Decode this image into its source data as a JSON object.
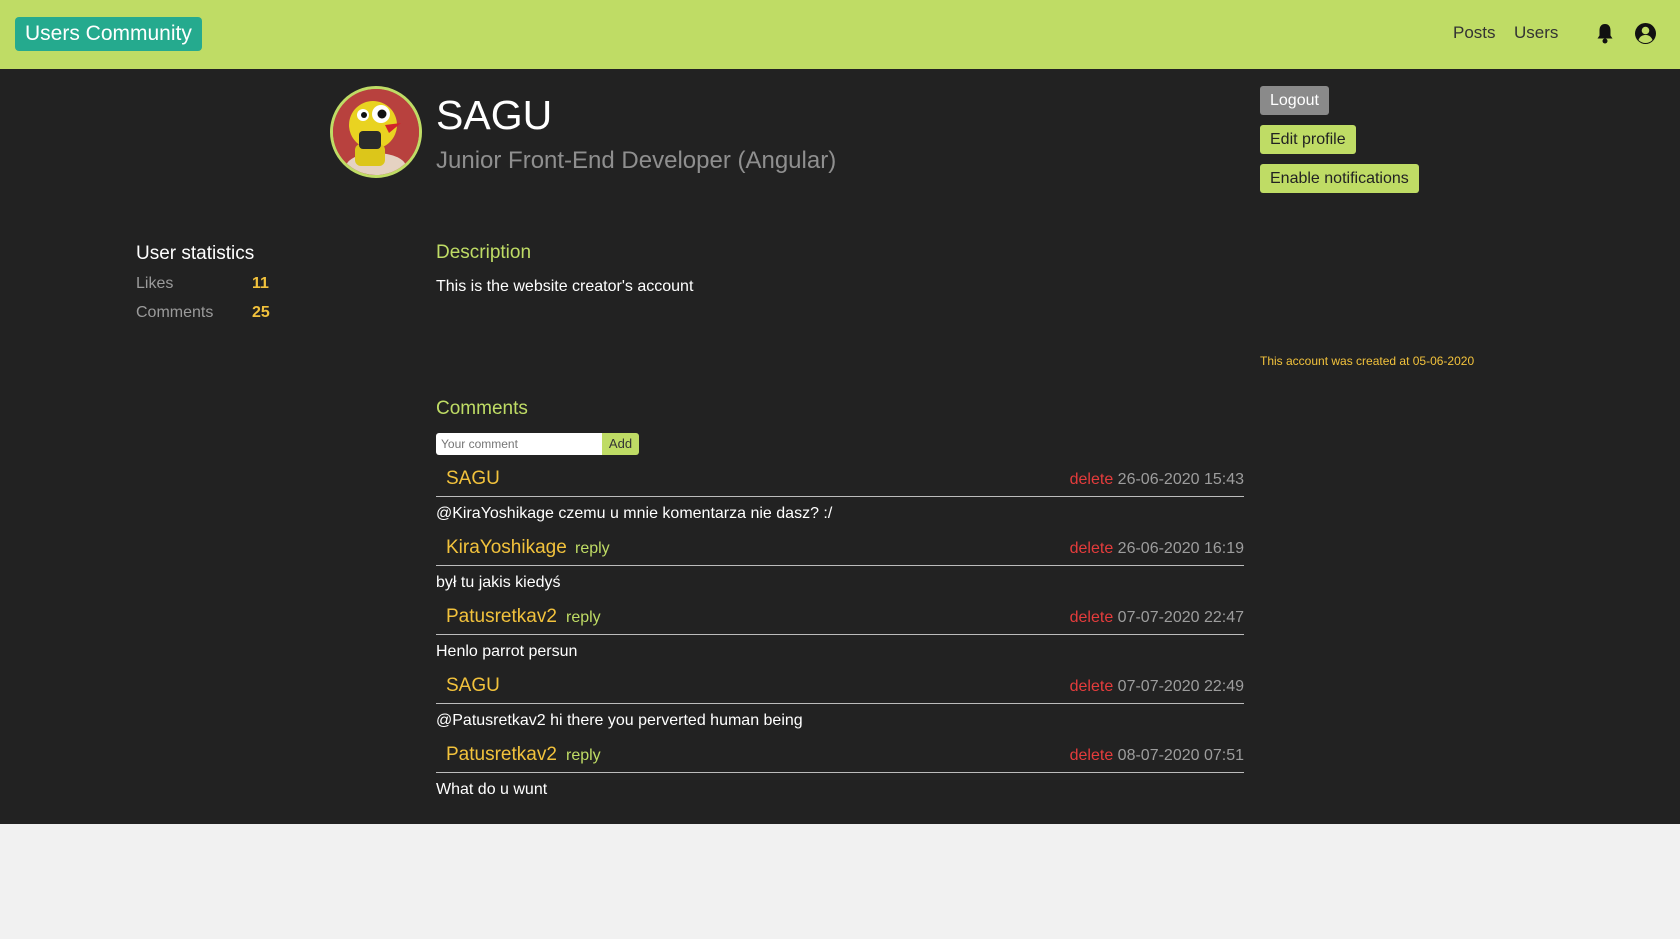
{
  "header": {
    "brand": "Users Community",
    "nav": [
      "Posts",
      "Users"
    ],
    "icons": [
      "bell-icon",
      "account-circle-icon"
    ],
    "colors": {
      "bar": "#bfdc65",
      "brand": "#25aa8e"
    }
  },
  "profile": {
    "name": "SAGU",
    "job": "Junior Front-End Developer (Angular)"
  },
  "actions": {
    "logout": "Logout",
    "edit_profile": "Edit profile",
    "enable_notifications": "Enable notifications"
  },
  "stats": {
    "title": "User statistics",
    "likes_label": "Likes",
    "likes_value": "11",
    "comments_label": "Comments",
    "comments_value": "25"
  },
  "description": {
    "title": "Description",
    "text": "This is the website creator's account"
  },
  "created_text": "This account was created at 05-06-2020",
  "comments": {
    "title": "Comments",
    "input_placeholder": "Your comment",
    "add_label": "Add",
    "items": [
      {
        "author": "SAGU",
        "reply": "",
        "delete": "delete",
        "date": "26-06-2020 15:43",
        "text": "@KiraYoshikage czemu u mnie komentarza nie dasz? :/"
      },
      {
        "author": "KiraYoshikage",
        "reply": "reply",
        "delete": "delete",
        "date": "26-06-2020 16:19",
        "text": "był tu jakis kiedyś"
      },
      {
        "author": "Patusretkav2",
        "reply": "reply",
        "delete": "delete",
        "date": "07-07-2020 22:47",
        "text": "Henlo parrot persun"
      },
      {
        "author": "SAGU",
        "reply": "",
        "delete": "delete",
        "date": "07-07-2020 22:49",
        "text": "@Patusretkav2 hi there you perverted human being"
      },
      {
        "author": "Patusretkav2",
        "reply": "reply",
        "delete": "delete",
        "date": "08-07-2020 07:51",
        "text": "What do u wunt"
      }
    ]
  }
}
